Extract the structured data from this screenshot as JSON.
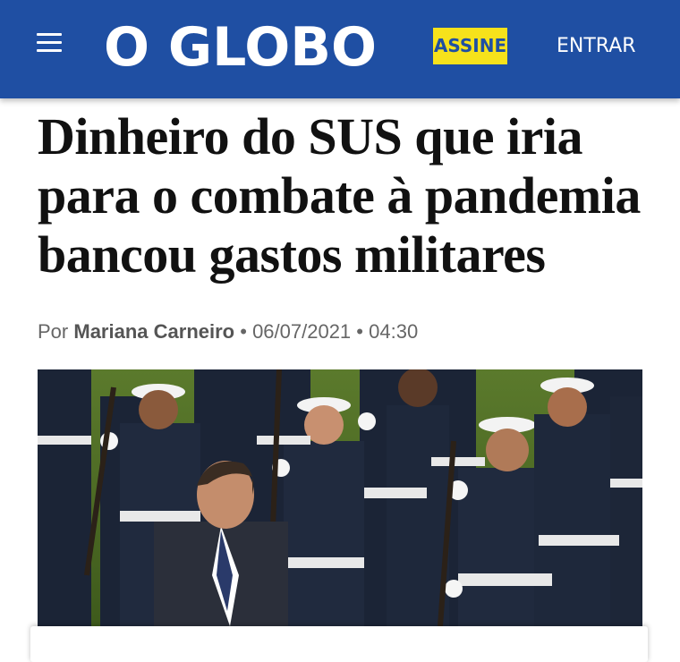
{
  "header": {
    "menu_icon": "hamburger-menu-icon",
    "logo_text": "O GLOBO",
    "subscribe_label": "ASSINE",
    "login_label": "ENTRAR",
    "brand_color": "#1f4fa3",
    "subscribe_color": "#f6e21b"
  },
  "article": {
    "headline": "Dinheiro do SUS que iria para o combate à pandemia bancou gastos militares",
    "byline_prefix": "Por",
    "author": "Mariana Carneiro",
    "separator": "•",
    "date": "06/07/2021",
    "time": "04:30",
    "hero_image": "photo-military-parade-navy-sailors"
  }
}
